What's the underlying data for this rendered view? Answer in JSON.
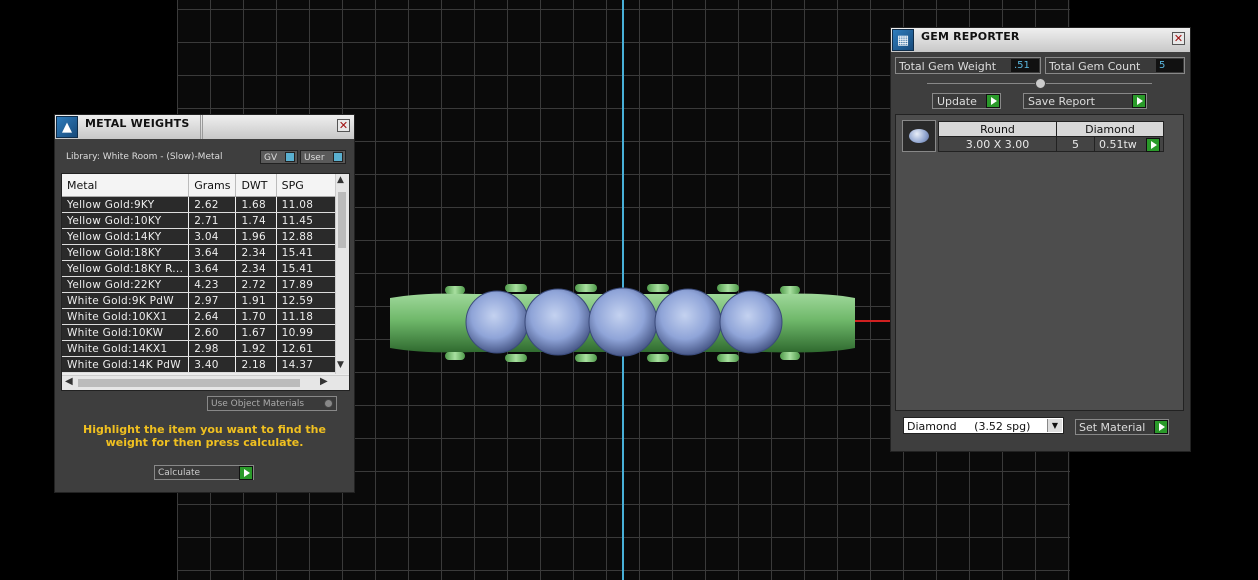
{
  "metal_weights": {
    "title": "METAL WEIGHTS",
    "library_label": "Library: White Room - (Slow)-Metal",
    "gv_label": "GV",
    "user_label": "User",
    "columns": [
      "Metal",
      "Grams",
      "DWT",
      "SPG"
    ],
    "rows": [
      [
        "Yellow Gold:9KY",
        "2.62",
        "1.68",
        "11.08"
      ],
      [
        "Yellow Gold:10KY",
        "2.71",
        "1.74",
        "11.45"
      ],
      [
        "Yellow Gold:14KY",
        "3.04",
        "1.96",
        "12.88"
      ],
      [
        "Yellow Gold:18KY",
        "3.64",
        "2.34",
        "15.41"
      ],
      [
        "Yellow Gold:18KY R...",
        "3.64",
        "2.34",
        "15.41"
      ],
      [
        "Yellow Gold:22KY",
        "4.23",
        "2.72",
        "17.89"
      ],
      [
        "White Gold:9K PdW",
        "2.97",
        "1.91",
        "12.59"
      ],
      [
        "White Gold:10KX1",
        "2.64",
        "1.70",
        "11.18"
      ],
      [
        "White Gold:10KW",
        "2.60",
        "1.67",
        "10.99"
      ],
      [
        "White Gold:14KX1",
        "2.98",
        "1.92",
        "12.61"
      ],
      [
        "White Gold:14K PdW",
        "3.40",
        "2.18",
        "14.37"
      ]
    ],
    "use_object_materials": "Use Object Materials",
    "hint": "Highlight the item you want to find the weight for then press calculate.",
    "calculate_label": "Calculate"
  },
  "gem_reporter": {
    "title": "GEM REPORTER",
    "total_weight_label": "Total Gem Weight",
    "total_weight_value": ".51",
    "total_count_label": "Total Gem Count",
    "total_count_value": "5",
    "update_label": "Update",
    "save_report_label": "Save Report",
    "gem_row": {
      "shape": "Round",
      "material": "Diamond",
      "size": "3.00 X 3.00",
      "count": "5",
      "weight": "0.51tw"
    },
    "material_select": "Diamond     (3.52 spg)",
    "set_material_label": "Set Material"
  },
  "colors": {
    "accent_play": "#2a9a2a",
    "hint_yellow": "#f0c020",
    "axis_blue": "#48b0d8",
    "axis_red": "#d02020",
    "ring_green": "#6fb86a",
    "gem_blue": "#8fa4d8"
  }
}
